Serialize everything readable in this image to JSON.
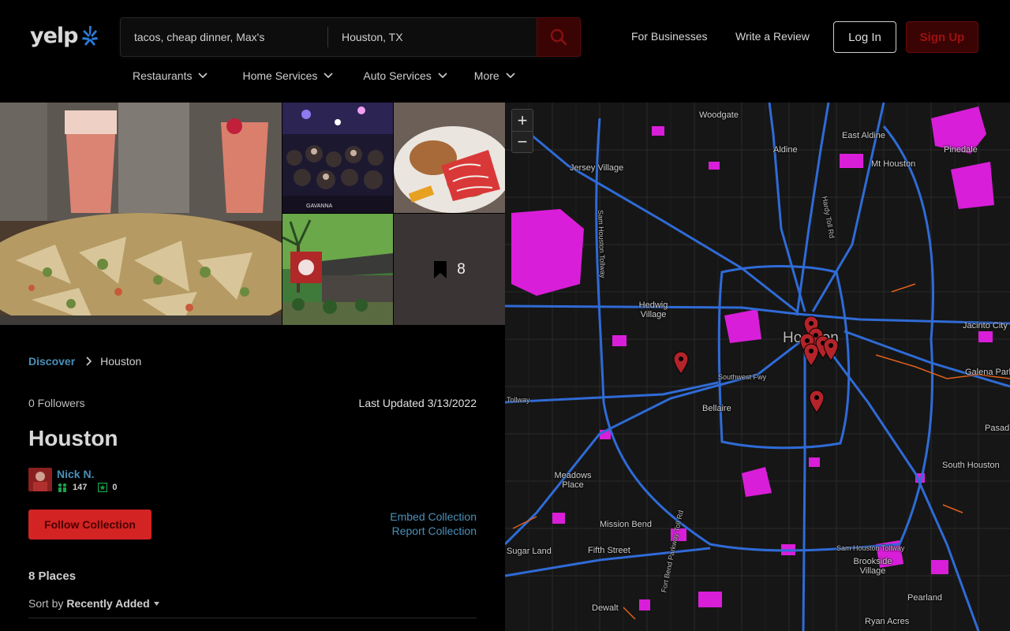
{
  "header": {
    "logo": "yelp",
    "search": {
      "find_value": "tacos, cheap dinner, Max's",
      "near_value": "Houston, TX"
    },
    "nav": {
      "for_businesses": "For Businesses",
      "write_review": "Write a Review",
      "login": "Log In",
      "signup": "Sign Up"
    },
    "categories": [
      {
        "label": "Restaurants"
      },
      {
        "label": "Home Services"
      },
      {
        "label": "Auto Services"
      },
      {
        "label": "More"
      }
    ]
  },
  "photos": {
    "club_caption": "GAVANNA",
    "save_count": "8"
  },
  "breadcrumb": {
    "root": "Discover",
    "current": "Houston"
  },
  "collection": {
    "followers": "0 Followers",
    "last_updated": "Last Updated 3/13/2022",
    "title": "Houston",
    "owner": {
      "name": "Nick N.",
      "friends": "147",
      "reviews": "0"
    },
    "follow_button": "Follow Collection",
    "embed_link": "Embed Collection",
    "report_link": "Report Collection",
    "places_count": "8 Places",
    "sort_label": "Sort by",
    "sort_value": "Recently Added"
  },
  "map": {
    "zoom_in": "+",
    "zoom_out": "−",
    "labels": {
      "woodgate": "Woodgate",
      "east_aldine": "East Aldine",
      "aldine": "Aldine",
      "jersey_village": "Jersey Village",
      "mt_houston": "Mt Houston",
      "pinedale": "Pinedale",
      "hedwig_village": "Hedwig Village",
      "houston": "Houston",
      "jacinto_city": "Jacinto City",
      "galena_park": "Galena Park",
      "bellaire": "Bellaire",
      "pasadena": "Pasad",
      "meadows_place": "Meadows Place",
      "south_houston": "South Houston",
      "mission_bend": "Mission Bend",
      "fifth_street": "Fifth Street",
      "brookside_village": "Brookside Village",
      "pearland": "Pearland",
      "sugar_land": "Sugar Land",
      "dewalt": "Dewalt",
      "ryan_acres": "Ryan Acres",
      "sam_houston_tollway": "Sam Houston Tollway",
      "southwest_fwy": "Southwest Fwy",
      "tollway": "Tollway",
      "hardy_toll_rd": "Hardy Toll Rd",
      "fort_bend_pkwy": "Fort Bend Parkway Toll Rd",
      "sam_houston_tollway_w": "Sam Houston Tollway"
    }
  },
  "colors": {
    "accent_red": "#d32323",
    "link_blue": "#4a90b8",
    "map_highway": "#2f6bd6",
    "park_magenta": "#e020e0"
  }
}
